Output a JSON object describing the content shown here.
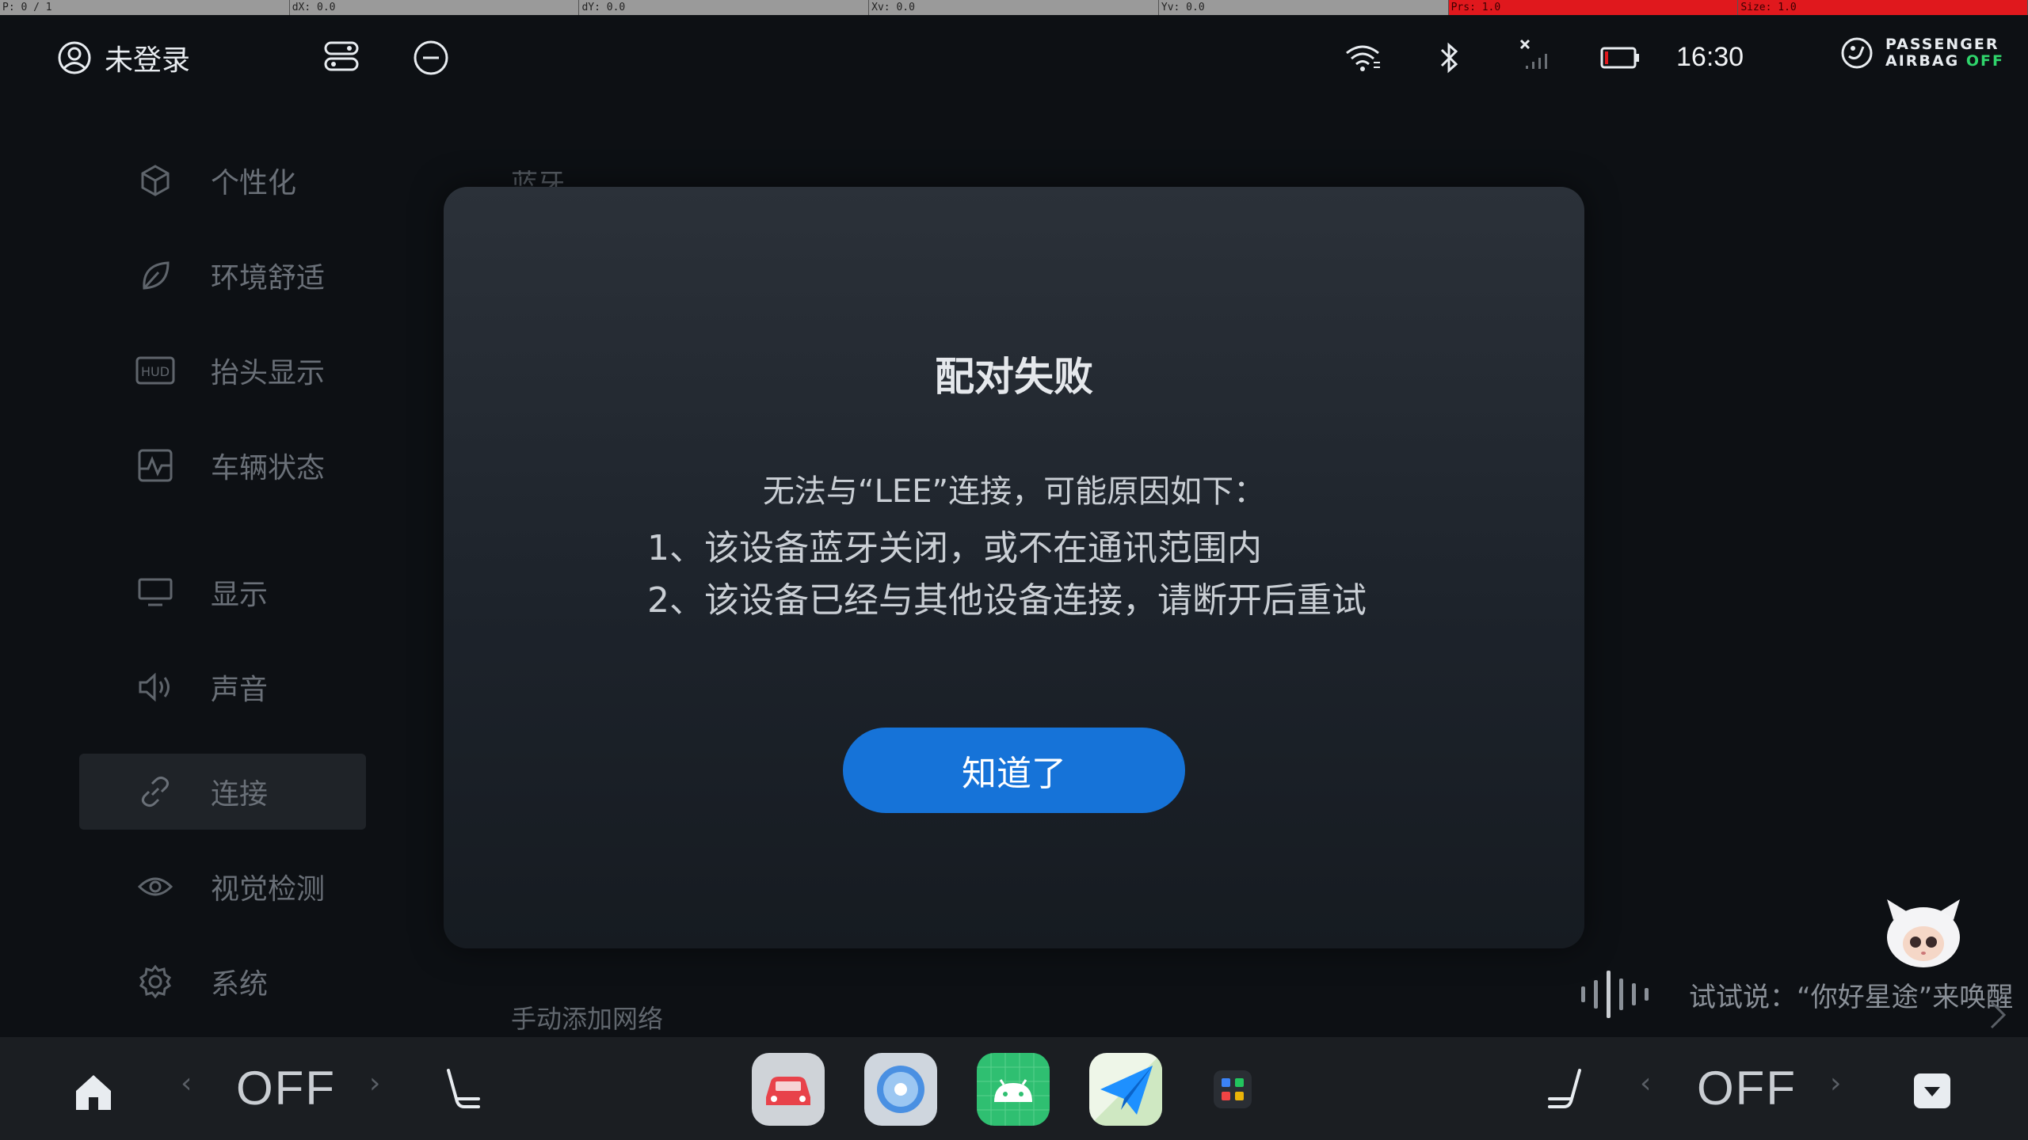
{
  "debug": [
    "P: 0 / 1",
    "dX: 0.0",
    "dY: 0.0",
    "Xv: 0.0",
    "Yv: 0.0",
    "Prs: 1.0",
    "Size: 1.0"
  ],
  "status": {
    "user_label": "未登录",
    "time": "16:30",
    "airbag_line1": "PASSENGER",
    "airbag_line2": "AIRBAG",
    "airbag_state": "OFF",
    "airbag_state_color": "#2fd46b"
  },
  "sidebar": {
    "items": [
      {
        "label": "个性化",
        "icon": "cube-icon"
      },
      {
        "label": "环境舒适",
        "icon": "leaf-icon"
      },
      {
        "label": "抬头显示",
        "icon": "hud-icon"
      },
      {
        "label": "车辆状态",
        "icon": "vehicle-status-icon"
      },
      {
        "label": "显示",
        "icon": "monitor-icon"
      },
      {
        "label": "声音",
        "icon": "speaker-icon"
      },
      {
        "label": "连接",
        "icon": "link-icon"
      },
      {
        "label": "视觉检测",
        "icon": "eye-icon"
      },
      {
        "label": "系统",
        "icon": "gear-icon"
      }
    ],
    "active_index": 6
  },
  "background_page": {
    "section_title": "蓝牙",
    "manual_add": "手动添加网络"
  },
  "dialog": {
    "title": "配对失败",
    "message": "无法与“LEE”连接，可能原因如下：",
    "reasons": [
      "1、该设备蓝牙关闭，或不在通讯范围内",
      "2、该设备已经与其他设备连接，请断开后重试"
    ],
    "confirm_label": "知道了",
    "accent": "#1673d8"
  },
  "voice": {
    "hint": "试试说：“你好星途”来唤醒"
  },
  "dock": {
    "left_temp": "OFF",
    "right_temp": "OFF"
  }
}
